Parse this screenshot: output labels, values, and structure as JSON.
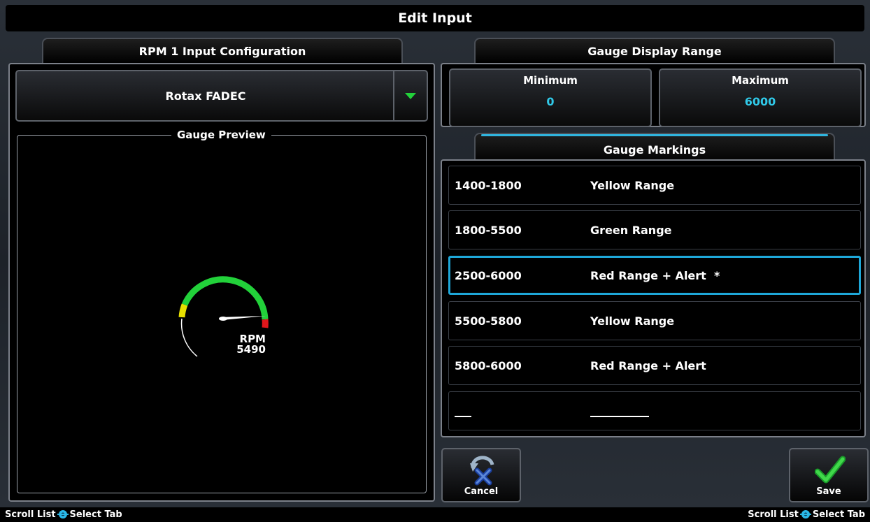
{
  "window": {
    "title": "Edit Input"
  },
  "left_tab": {
    "label": "RPM 1 Input Configuration"
  },
  "right_tab": {
    "label": "Gauge Display Range"
  },
  "source_dropdown": {
    "selected": "Rotax FADEC"
  },
  "preview": {
    "title": "Gauge Preview",
    "gauge_label": "RPM",
    "gauge_value": "5490"
  },
  "range": {
    "minimum_label": "Minimum",
    "minimum_value": "0",
    "maximum_label": "Maximum",
    "maximum_value": "6000"
  },
  "markings": {
    "tab_label": "Gauge Markings",
    "rows": [
      {
        "range": "1400-1800",
        "desc": "Yellow Range"
      },
      {
        "range": "1800-5500",
        "desc": "Green Range"
      },
      {
        "range": "2500-6000",
        "desc": "Red Range + Alert  *"
      },
      {
        "range": "5500-5800",
        "desc": "Yellow Range"
      },
      {
        "range": "5800-6000",
        "desc": "Red Range + Alert"
      }
    ]
  },
  "buttons": {
    "cancel": "Cancel",
    "save": "Save"
  },
  "status": {
    "left_scroll": "Scroll List",
    "left_select": "Select Tab",
    "right_scroll": "Scroll List",
    "right_select": "Select Tab"
  },
  "colors": {
    "accent": "#30c9e8",
    "selection": "#1ea7d8",
    "green": "#22d13a",
    "yellow": "#e8e000",
    "red": "#e0161b"
  }
}
